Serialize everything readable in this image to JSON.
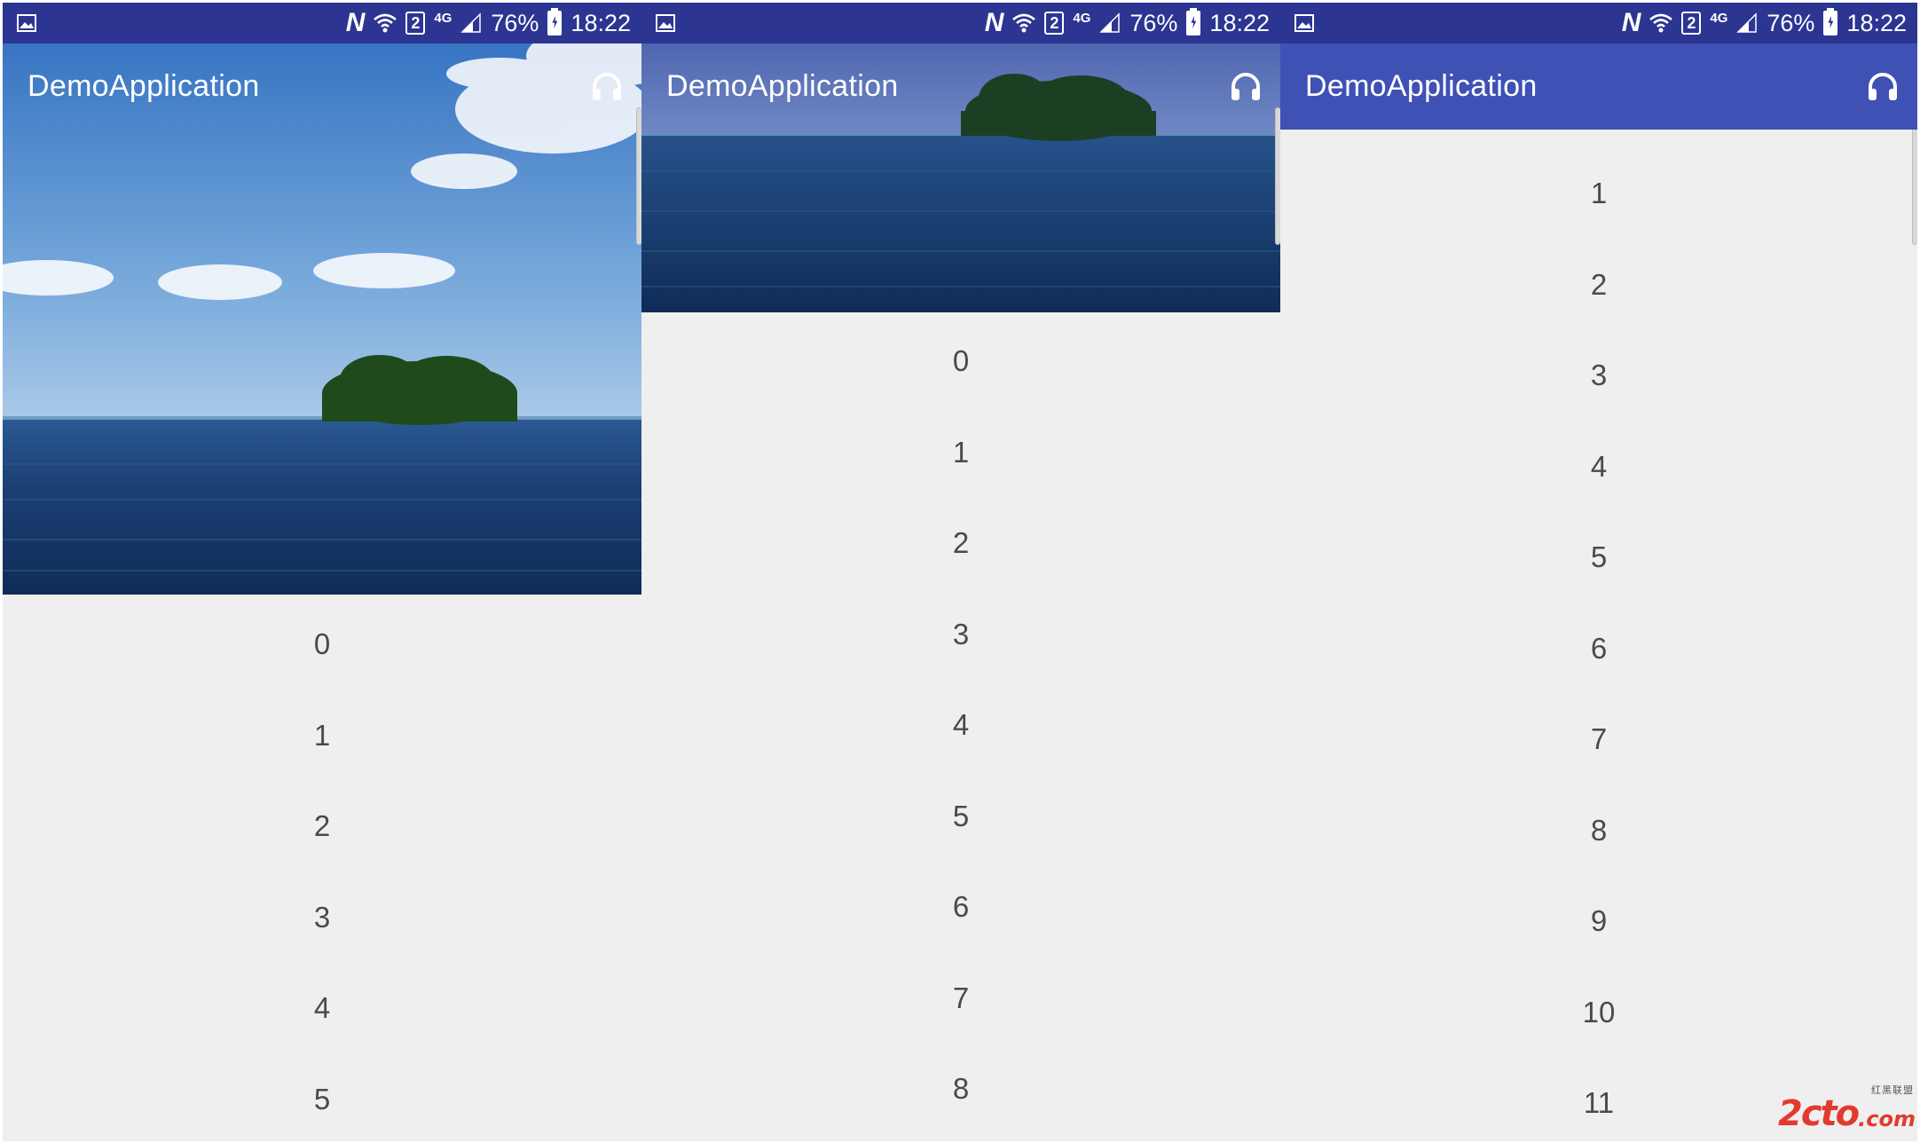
{
  "status_bar": {
    "battery": "76%",
    "time": "18:22",
    "sim_slot": "2",
    "network": "4G",
    "icons": [
      "gallery-notification-icon",
      "nfc-icon",
      "wifi-icon",
      "sim-icon",
      "signal-icon",
      "battery-charging-icon"
    ]
  },
  "app": {
    "title": "DemoApplication",
    "toolbar_icon": "headset-icon",
    "primary_color": "#3f51b5",
    "status_color": "#2c3592",
    "background": "#efefef"
  },
  "panels": [
    {
      "state": "expanded",
      "items": [
        "0",
        "1",
        "2",
        "3",
        "4",
        "5"
      ]
    },
    {
      "state": "collapsing",
      "items": [
        "0",
        "1",
        "2",
        "3",
        "4",
        "5",
        "6",
        "7",
        "8"
      ]
    },
    {
      "state": "collapsed",
      "items": [
        "1",
        "2",
        "3",
        "4",
        "5",
        "6",
        "7",
        "8",
        "9",
        "10",
        "11"
      ]
    }
  ],
  "watermark": {
    "main": "2cto",
    "sub": ".com",
    "cn": "红黑联盟"
  }
}
